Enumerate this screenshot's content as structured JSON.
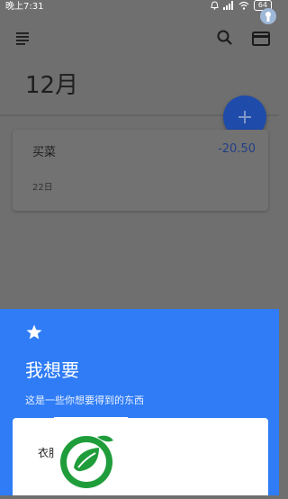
{
  "status_bar": {
    "time": "晚上7:31",
    "battery": "64"
  },
  "app_bar": {
    "icons": [
      "menu-icon",
      "search-icon",
      "card-icon"
    ]
  },
  "month": "12月",
  "record": {
    "name": "买菜",
    "amount": "-20.50",
    "date": "22日"
  },
  "sheet": {
    "title": "我想要",
    "description": "这是一些你想要得到的东西",
    "input_text": "衣服"
  },
  "colors": {
    "sheet": "#2f7cf6",
    "fab": "#1f4caa",
    "amount": "#223f86"
  }
}
